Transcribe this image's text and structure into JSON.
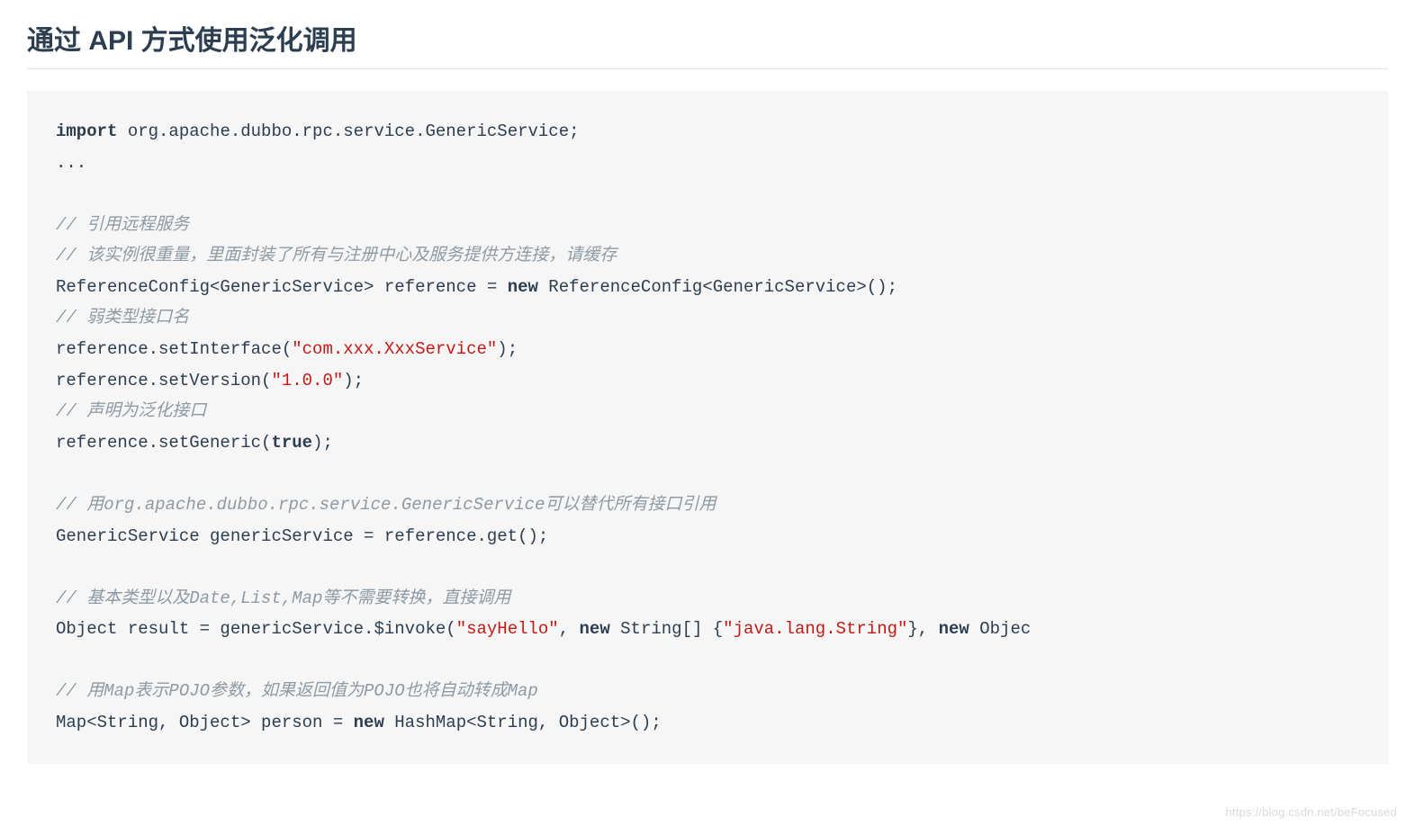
{
  "heading": "通过 API 方式使用泛化调用",
  "code": {
    "l1_kw": "import",
    "l1_rest": " org.apache.dubbo.rpc.service.GenericService;",
    "l2": "...",
    "l3_cm": "// 引用远程服务 ",
    "l4_cm": "// 该实例很重量，里面封装了所有与注册中心及服务提供方连接，请缓存",
    "l5_a": "ReferenceConfig<GenericService> reference = ",
    "l5_kw": "new",
    "l5_b": " ReferenceConfig<GenericService>();",
    "l6_cm": "// 弱类型接口名  ",
    "l7_a": "reference.setInterface(",
    "l7_s": "\"com.xxx.XxxService\"",
    "l7_b": ");",
    "l8_a": "reference.setVersion(",
    "l8_s": "\"1.0.0\"",
    "l8_b": ");",
    "l9_cm": "// 声明为泛化接口  ",
    "l10_a": "reference.setGeneric(",
    "l10_kw": "true",
    "l10_b": ");",
    "l11_cm": "// 用org.apache.dubbo.rpc.service.GenericService可以替代所有接口引用  ",
    "l12": "GenericService genericService = reference.get();",
    "l13_cm": "// 基本类型以及Date,List,Map等不需要转换，直接调用 ",
    "l14_a": "Object result = genericService.$invoke(",
    "l14_s1": "\"sayHello\"",
    "l14_b": ", ",
    "l14_kw1": "new",
    "l14_c": " String[] {",
    "l14_s2": "\"java.lang.String\"",
    "l14_d": "}, ",
    "l14_kw2": "new",
    "l14_e": " Objec",
    "l15_cm": "// 用Map表示POJO参数，如果返回值为POJO也将自动转成Map ",
    "l16_a": "Map<String, Object> person = ",
    "l16_kw": "new",
    "l16_b": " HashMap<String, Object>();"
  },
  "watermark": "https://blog.csdn.net/beFocused"
}
